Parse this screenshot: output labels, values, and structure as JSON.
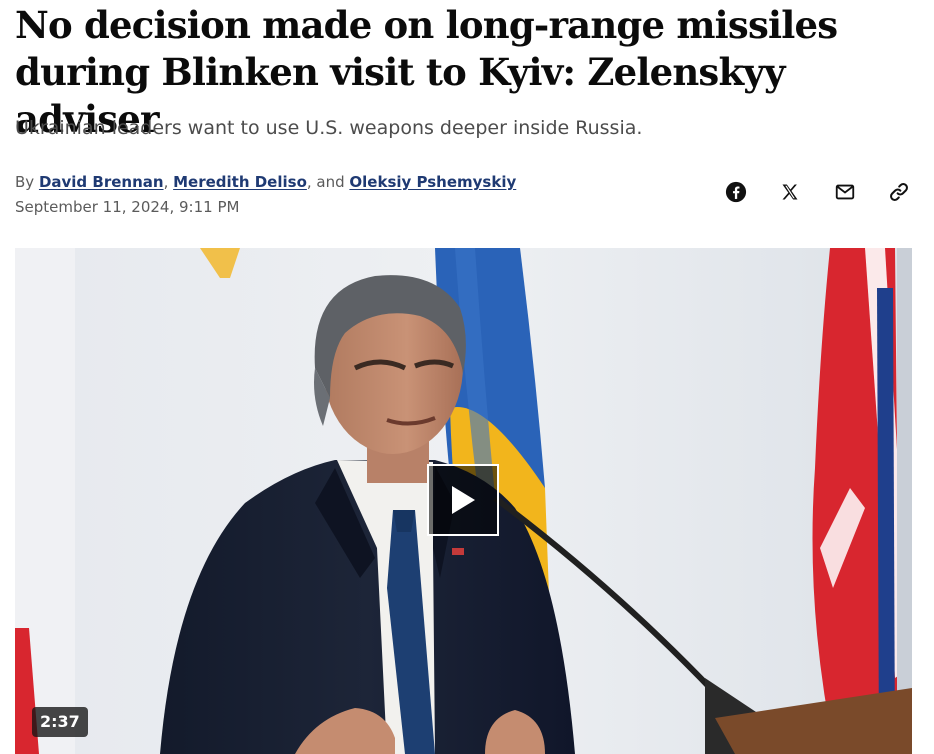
{
  "article": {
    "headline": "No decision made on long-range missiles during Blinken visit to Kyiv: Zelenskyy adviser",
    "dek": "Ukrainian leaders want to use U.S. weapons deeper inside Russia.",
    "byline": {
      "prefix": "By ",
      "authors": [
        "David Brennan",
        "Meredith Deliso",
        "Oleksiy Pshemyskiy"
      ],
      "separator": ", ",
      "conjunction": ", and "
    },
    "timestamp": "September 11, 2024, 9:11 PM"
  },
  "share": {
    "icons": [
      "facebook-icon",
      "x-icon",
      "email-icon",
      "link-icon"
    ]
  },
  "video": {
    "duration": "2:37",
    "play_icon": "play-icon"
  },
  "colors": {
    "author_link": "#1f3a73",
    "ukraine_blue": "#2a63b8",
    "ukraine_yellow": "#f2b51c",
    "uk_red": "#d8262f",
    "uk_blue": "#1f3f8c"
  }
}
